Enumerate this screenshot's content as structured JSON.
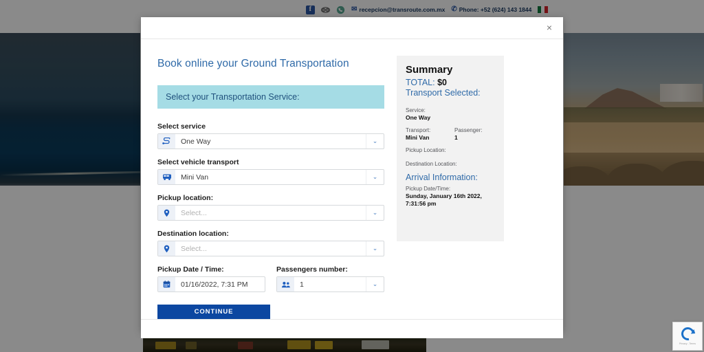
{
  "topbar": {
    "social": [
      {
        "name": "facebook-icon",
        "label": "f"
      },
      {
        "name": "tripadvisor-icon",
        "label": ""
      },
      {
        "name": "whatsapp-icon",
        "label": ""
      }
    ],
    "email_icon": "✉",
    "email": "recepcion@transroute.com.mx",
    "phone_icon": "✆",
    "phone": "Phone: +52 (624) 143 1844",
    "flag": "mexico-flag"
  },
  "modal": {
    "close_label": "×",
    "form": {
      "title": "Book online your Ground Transportation",
      "banner": "Select your Transportation Service:",
      "fields": [
        {
          "key": "service",
          "label": "Select service",
          "icon": "route-icon",
          "value": "One Way",
          "is_placeholder": false,
          "caret": "⌄"
        },
        {
          "key": "vehicle",
          "label": "Select vehicle transport",
          "icon": "van-icon",
          "value": "Mini Van",
          "is_placeholder": false,
          "caret": "⌄"
        },
        {
          "key": "pickup_location",
          "label": "Pickup location:",
          "icon": "map-pin-icon",
          "value": "Select...",
          "is_placeholder": true,
          "caret": "⌄"
        },
        {
          "key": "destination_location",
          "label": "Destination location:",
          "icon": "map-pin-icon",
          "value": "Select...",
          "is_placeholder": true,
          "caret": "⌄"
        }
      ],
      "date_field": {
        "label": "Pickup Date / Time:",
        "icon": "calendar-icon",
        "value": "01/16/2022, 7:31 PM"
      },
      "passengers_field": {
        "label": "Passengers number:",
        "icon": "passengers-icon",
        "value": "1",
        "caret": "⌄"
      },
      "continue_label": "CONTINUE"
    },
    "summary": {
      "title": "Summary",
      "total_label": "TOTAL:",
      "total_value": "$0",
      "transport_selected_label": "Transport Selected:",
      "service_label": "Service:",
      "service_value": "One Way",
      "transport_label": "Transport:",
      "transport_value": "Mini Van",
      "passenger_label": "Passenger:",
      "passenger_value": "1",
      "pickup_location_label": "Pickup Location:",
      "destination_location_label": "Destination Location:",
      "arrival_title": "Arrival Information:",
      "pickup_datetime_label": "Pickup Date/Time:",
      "pickup_datetime_value": "Sunday, January 16th 2022, 7:31:56 pm"
    }
  },
  "recaptcha": {
    "name": "recaptcha-badge",
    "text": "Privacy - Terms"
  },
  "colors": {
    "accent_blue": "#2f6aa8",
    "button_blue": "#0c47a1",
    "banner_teal": "#a5dce5",
    "summary_bg": "#f2f2f2",
    "icon_blue": "#1f5fbf"
  }
}
